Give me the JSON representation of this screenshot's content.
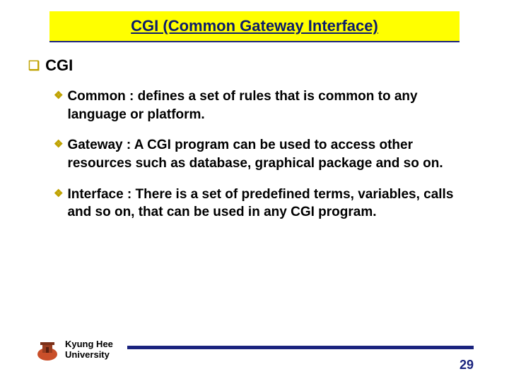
{
  "title": "CGI (Common Gateway Interface)",
  "heading": "CGI",
  "items": [
    "Common : defines a set of rules that is common to any language or platform.",
    "Gateway : A CGI program can be used to access other resources such as database, graphical package and so on.",
    "Interface : There is a set of predefined terms, variables, calls and so on,  that can be used in any CGI program."
  ],
  "footer": {
    "university_line1": "Kyung Hee",
    "university_line2": "University",
    "page": "29"
  },
  "colors": {
    "title_bg": "#ffff00",
    "accent": "#1a237e",
    "bullet": "#bfa200"
  }
}
